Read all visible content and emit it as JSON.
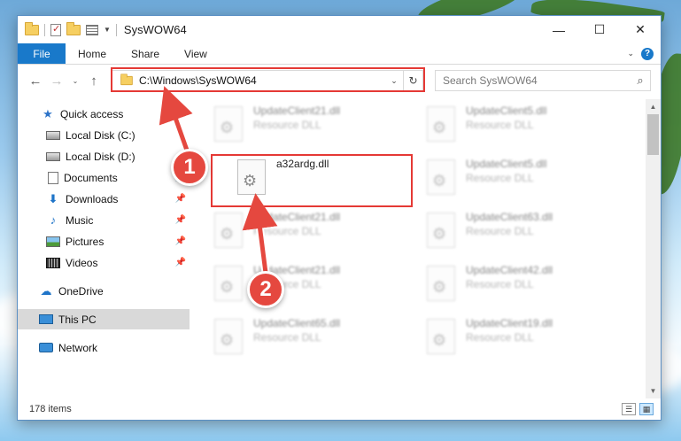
{
  "window": {
    "title": "SysWOW64",
    "controls": {
      "minimize": "—",
      "maximize": "☐",
      "close": "✕"
    }
  },
  "ribbon": {
    "tabs": [
      "File",
      "Home",
      "Share",
      "View"
    ],
    "collapse_glyph": "⌄",
    "help_glyph": "?"
  },
  "nav": {
    "back": "←",
    "forward": "→",
    "recent": "⌄",
    "up": "↑",
    "address": "C:\\Windows\\SysWOW64",
    "address_dropdown": "⌄",
    "refresh": "↻",
    "search_placeholder": "Search SysWOW64",
    "search_glyph": "⌕"
  },
  "sidebar": {
    "items": [
      {
        "label": "Quick access",
        "icon": "star-icon",
        "glyph": "★"
      },
      {
        "label": "Local Disk (C:)",
        "icon": "disk-icon"
      },
      {
        "label": "Local Disk (D:)",
        "icon": "disk-icon"
      },
      {
        "label": "Documents",
        "icon": "documents-icon",
        "pin": "📌"
      },
      {
        "label": "Downloads",
        "icon": "downloads-icon",
        "glyph": "⬇",
        "pin": "📌"
      },
      {
        "label": "Music",
        "icon": "music-icon",
        "glyph": "♪",
        "pin": "📌"
      },
      {
        "label": "Pictures",
        "icon": "pictures-icon",
        "pin": "📌"
      },
      {
        "label": "Videos",
        "icon": "videos-icon",
        "pin": "📌"
      },
      {
        "label": "OneDrive",
        "icon": "onedrive-icon",
        "glyph": "☁"
      },
      {
        "label": "This PC",
        "icon": "this-pc-icon",
        "selected": true
      },
      {
        "label": "Network",
        "icon": "network-icon"
      }
    ]
  },
  "files": {
    "left": [
      {
        "name": "UpdateClient21.dll",
        "type": "Resource DLL"
      },
      {
        "name": "a32ardg.dll",
        "type": ""
      },
      {
        "name": "UpdateClient21.dll",
        "type": "Resource DLL"
      },
      {
        "name": "UpdateClient21.dll",
        "type": "Resource DLL"
      },
      {
        "name": "UpdateClient65.dll",
        "type": "Resource DLL"
      }
    ],
    "right": [
      {
        "name": "UpdateClient5.dll",
        "type": "Resource DLL"
      },
      {
        "name": "UpdateClient5.dll",
        "type": "Resource DLL"
      },
      {
        "name": "UpdateClient63.dll",
        "type": "Resource DLL"
      },
      {
        "name": "UpdateClient42.dll",
        "type": "Resource DLL"
      },
      {
        "name": "UpdateClient19.dll",
        "type": "Resource DLL"
      }
    ],
    "gear_glyph": "⚙"
  },
  "status": {
    "count": "178 items"
  },
  "annotations": {
    "badge1": "1",
    "badge2": "2",
    "accent": "#e5483f"
  },
  "colors": {
    "file_tab": "#1979ca",
    "highlight": "#e53935",
    "selected_nav": "#d9d9d9"
  }
}
